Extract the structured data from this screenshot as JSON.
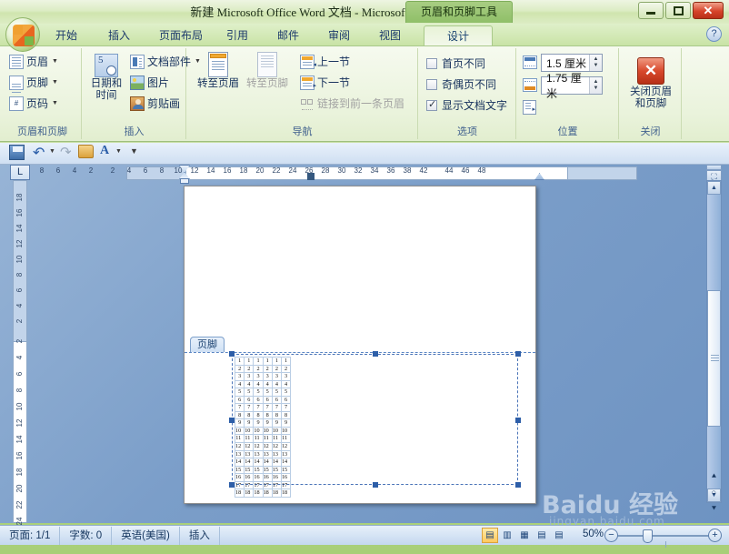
{
  "window": {
    "title": "新建 Microsoft Office Word 文档 - Microsoft Word",
    "contextual_tab_label": "页眉和页脚工具",
    "minimize": "最小化",
    "maximize": "最大化",
    "close": "✕"
  },
  "tabs": [
    {
      "label": "开始",
      "active": false
    },
    {
      "label": "插入",
      "active": false
    },
    {
      "label": "页面布局",
      "active": false
    },
    {
      "label": "引用",
      "active": false
    },
    {
      "label": "邮件",
      "active": false
    },
    {
      "label": "审阅",
      "active": false
    },
    {
      "label": "视图",
      "active": false
    },
    {
      "label": "设计",
      "active": true
    }
  ],
  "help_icon": "?",
  "quick_access": {
    "items": [
      {
        "name": "save-icon",
        "glyph": "💾"
      },
      {
        "name": "undo-icon",
        "glyph": "↶"
      },
      {
        "name": "undo-dropdown-icon",
        "glyph": "▾"
      },
      {
        "name": "redo-icon",
        "glyph": "↷"
      },
      {
        "name": "open-icon",
        "glyph": "📂"
      },
      {
        "name": "format-icon",
        "glyph": "A"
      },
      {
        "name": "format-dropdown-icon",
        "glyph": "▾"
      },
      {
        "name": "customize-qat-icon",
        "glyph": "▾"
      }
    ]
  },
  "ribbon": {
    "groups": [
      {
        "title": "页眉和页脚",
        "buttons": [
          {
            "label": "页眉",
            "dropdown": true,
            "icon": "header-icon"
          },
          {
            "label": "页脚",
            "dropdown": true,
            "icon": "footer-icon"
          },
          {
            "label": "页码",
            "dropdown": true,
            "icon": "page-number-icon"
          }
        ]
      },
      {
        "title": "插入",
        "big": {
          "line1": "日期和",
          "line2": "时间",
          "icon": "date-time-icon"
        },
        "buttons": [
          {
            "label": "文档部件",
            "dropdown": true,
            "icon": "quick-parts-icon"
          },
          {
            "label": "图片",
            "dropdown": false,
            "icon": "picture-icon"
          },
          {
            "label": "剪贴画",
            "dropdown": false,
            "icon": "clip-art-icon"
          }
        ]
      },
      {
        "title": "导航",
        "big_buttons": [
          {
            "label": "转至页眉",
            "icon": "goto-header-icon",
            "disabled": false
          },
          {
            "label": "转至页脚",
            "icon": "goto-footer-icon",
            "disabled": true
          }
        ],
        "buttons": [
          {
            "label": "上一节",
            "disabled": false,
            "icon": "previous-section-icon"
          },
          {
            "label": "下一节",
            "disabled": false,
            "icon": "next-section-icon"
          },
          {
            "label": "链接到前一条页眉",
            "disabled": true,
            "icon": "link-previous-icon"
          }
        ]
      },
      {
        "title": "选项",
        "checkboxes": [
          {
            "label": "首页不同",
            "checked": false
          },
          {
            "label": "奇偶页不同",
            "checked": false
          },
          {
            "label": "显示文档文字",
            "checked": true
          }
        ]
      },
      {
        "title": "位置",
        "spinners": [
          {
            "value": "1.5 厘米",
            "icon": "header-from-top-icon"
          },
          {
            "value": "1.75 厘米",
            "icon": "footer-from-bottom-icon"
          }
        ],
        "extra_button": {
          "icon": "insert-alignment-tab-icon"
        }
      },
      {
        "title": "关闭",
        "close_button": {
          "glyph": "✕",
          "line1": "关闭页眉",
          "line2": "和页脚"
        }
      }
    ]
  },
  "rulers": {
    "horizontal_ticks": [
      "8",
      "6",
      "4",
      "2",
      "2",
      "4",
      "6",
      "8",
      "10",
      "12",
      "14",
      "16",
      "18",
      "20",
      "22",
      "24",
      "26",
      "28",
      "30",
      "32",
      "34",
      "36",
      "38",
      "42",
      "44",
      "46",
      "48"
    ],
    "vertical_ticks": [
      "18",
      "16",
      "14",
      "12",
      "10",
      "8",
      "6",
      "4",
      "2",
      "2",
      "4",
      "6",
      "8",
      "10",
      "12",
      "14",
      "16",
      "18",
      "20",
      "22",
      "24"
    ],
    "corner_button": "L"
  },
  "document": {
    "footer_tag": "页脚",
    "table": {
      "columns": 6,
      "rows": [
        "1",
        "2",
        "3",
        "4",
        "5",
        "6",
        "7",
        "8",
        "9",
        "10",
        "11",
        "12",
        "13",
        "14",
        "15",
        "16",
        "17",
        "18"
      ]
    }
  },
  "scrollbar": {
    "up_arrow": "▲",
    "down_arrow": "▼",
    "split_handle": "",
    "browse_prev": "⯅",
    "browse_select": "○",
    "browse_next": "⯆",
    "select_object_icon": "⛶"
  },
  "status_bar": {
    "page": "页面: 1/1",
    "words": "字数: 0",
    "language": "英语(美国)",
    "mode": "插入",
    "view_buttons": [
      {
        "name": "print-layout-view",
        "glyph": "▤",
        "active": true
      },
      {
        "name": "full-screen-reading-view",
        "glyph": "▥",
        "active": false
      },
      {
        "name": "web-layout-view",
        "glyph": "▦",
        "active": false
      },
      {
        "name": "outline-view",
        "glyph": "▤",
        "active": false
      },
      {
        "name": "draft-view",
        "glyph": "▤",
        "active": false
      }
    ],
    "zoom_level": "50%",
    "zoom_out": "−",
    "zoom_in": "+"
  },
  "watermark": {
    "text": "Baidu 经验",
    "subtext": "jingyan.baidu.com"
  },
  "colors": {
    "ribbon_green": "#c9e3a6",
    "accent_blue": "#16315c",
    "close_red": "#d8492c",
    "page_white": "#ffffff"
  }
}
